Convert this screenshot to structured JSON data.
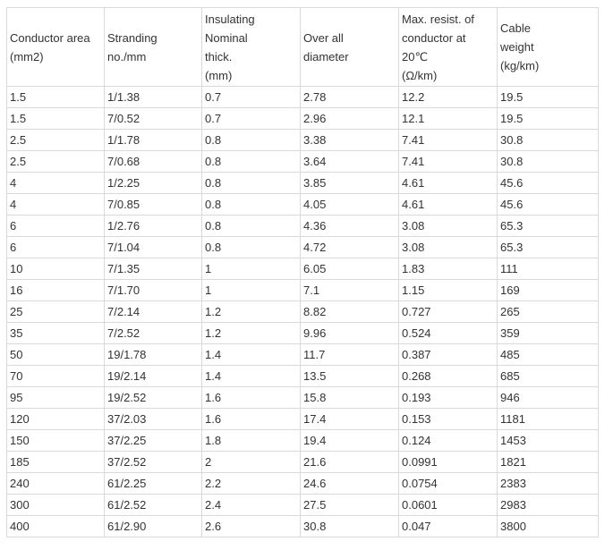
{
  "table": {
    "headers": [
      [
        "Conductor area",
        "(mm2)"
      ],
      [
        "Stranding",
        "no./mm"
      ],
      [
        "Insulating",
        "Nominal",
        "thick.",
        "(mm)"
      ],
      [
        "Over all",
        "diameter"
      ],
      [
        "Max. resist. of",
        "conductor at",
        "20℃",
        "(Ω/km)"
      ],
      [
        "Cable",
        "weight",
        "(kg/km)"
      ]
    ],
    "rows": [
      [
        "1.5",
        "1/1.38",
        "0.7",
        "2.78",
        "12.2",
        "19.5"
      ],
      [
        "1.5",
        "7/0.52",
        "0.7",
        "2.96",
        "12.1",
        "19.5"
      ],
      [
        "2.5",
        "1/1.78",
        "0.8",
        "3.38",
        "7.41",
        "30.8"
      ],
      [
        "2.5",
        "7/0.68",
        "0.8",
        "3.64",
        "7.41",
        "30.8"
      ],
      [
        "4",
        "1/2.25",
        "0.8",
        "3.85",
        "4.61",
        "45.6"
      ],
      [
        "4",
        "7/0.85",
        "0.8",
        "4.05",
        "4.61",
        "45.6"
      ],
      [
        "6",
        "1/2.76",
        "0.8",
        "4.36",
        "3.08",
        "65.3"
      ],
      [
        "6",
        "7/1.04",
        "0.8",
        "4.72",
        "3.08",
        "65.3"
      ],
      [
        "10",
        "7/1.35",
        "1",
        "6.05",
        "1.83",
        "111"
      ],
      [
        "16",
        "7/1.70",
        "1",
        "7.1",
        "1.15",
        "169"
      ],
      [
        "25",
        "7/2.14",
        "1.2",
        "8.82",
        "0.727",
        "265"
      ],
      [
        "35",
        "7/2.52",
        "1.2",
        "9.96",
        "0.524",
        "359"
      ],
      [
        "50",
        "19/1.78",
        "1.4",
        "11.7",
        "0.387",
        "485"
      ],
      [
        "70",
        "19/2.14",
        "1.4",
        "13.5",
        "0.268",
        "685"
      ],
      [
        "95",
        "19/2.52",
        "1.6",
        "15.8",
        "0.193",
        "946"
      ],
      [
        "120",
        "37/2.03",
        "1.6",
        "17.4",
        "0.153",
        "1181"
      ],
      [
        "150",
        "37/2.25",
        "1.8",
        "19.4",
        "0.124",
        "1453"
      ],
      [
        "185",
        "37/2.52",
        "2",
        "21.6",
        "0.0991",
        "1821"
      ],
      [
        "240",
        "61/2.25",
        "2.2",
        "24.6",
        "0.0754",
        "2383"
      ],
      [
        "300",
        "61/2.52",
        "2.4",
        "27.5",
        "0.0601",
        "2983"
      ],
      [
        "400",
        "61/2.90",
        "2.6",
        "30.8",
        "0.047",
        "3800"
      ]
    ]
  }
}
